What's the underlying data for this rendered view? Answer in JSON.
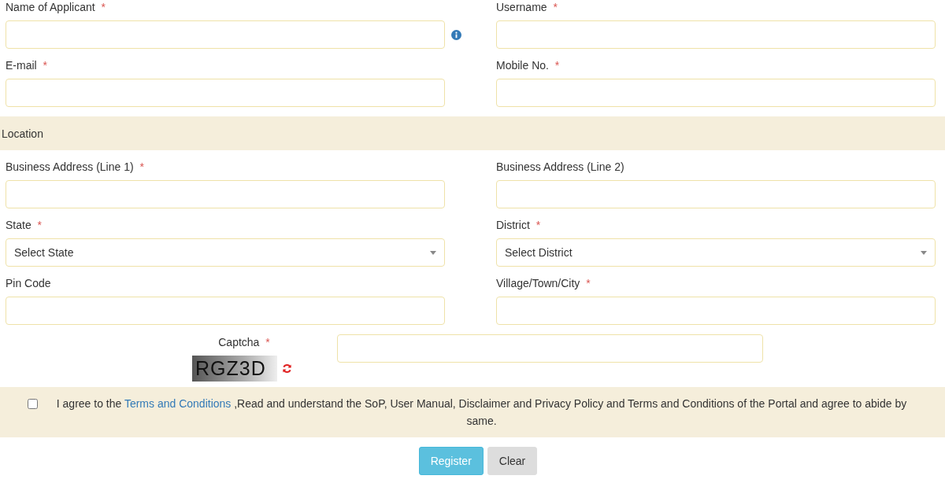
{
  "account_fields": [
    {
      "label": "Name of Applicant",
      "required_mark": "*",
      "kind": "text",
      "has_info": true
    },
    {
      "label": "Username",
      "required_mark": "*",
      "kind": "text"
    },
    {
      "label": "E-mail",
      "required_mark": "*",
      "kind": "text"
    },
    {
      "label": "Mobile No.",
      "required_mark": "*",
      "kind": "text"
    }
  ],
  "location": {
    "heading": "Location",
    "fields": [
      {
        "label": "Business Address (Line 1)",
        "required_mark": "*",
        "kind": "text"
      },
      {
        "label": "Business Address (Line 2)",
        "kind": "text"
      },
      {
        "label": "State",
        "required_mark": "*",
        "kind": "select",
        "value": "Select State"
      },
      {
        "label": "District",
        "required_mark": "*",
        "kind": "select",
        "value": "Select District"
      },
      {
        "label": "Pin Code",
        "kind": "text"
      },
      {
        "label": "Village/Town/City",
        "required_mark": "*",
        "kind": "text"
      }
    ]
  },
  "captcha": {
    "label": "Captcha",
    "required_mark": "*",
    "code": "RGZ3D"
  },
  "agreement": {
    "checked": false,
    "text_before": "I agree to the",
    "link": "Terms and Conditions",
    "text_after": ",Read and understand the SoP, User Manual, Disclaimer and Privacy Policy and Terms and Conditions of the Portal and agree to abide by same."
  },
  "buttons": [
    {
      "label": "Register",
      "kind": "primary"
    },
    {
      "label": "Clear",
      "kind": "default"
    }
  ]
}
